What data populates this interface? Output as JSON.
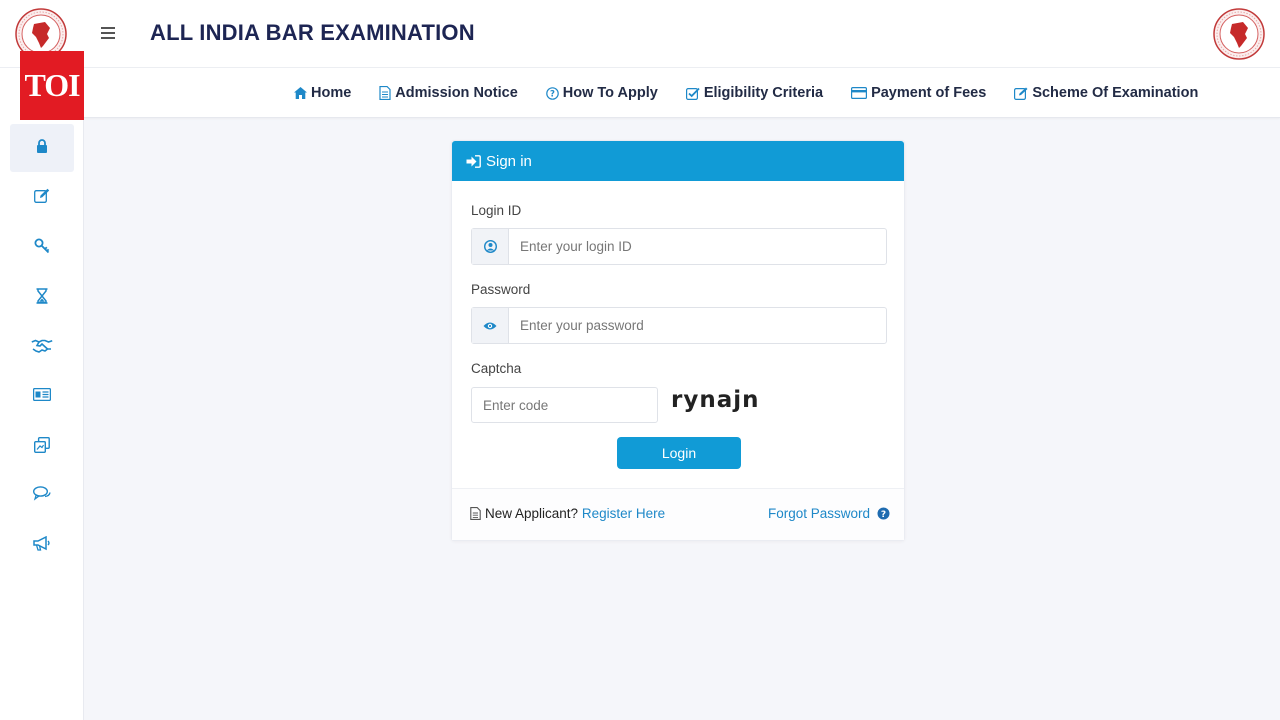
{
  "header": {
    "title": "ALL INDIA BAR EXAMINATION",
    "menu_icon": "hamburger-icon",
    "logo_left": "bar-council-emblem",
    "logo_right": "bar-council-emblem"
  },
  "overlay": {
    "badge": "TOI",
    "badge_color": "#e21b23"
  },
  "nav": {
    "items": [
      {
        "label": "Home",
        "icon": "home-icon"
      },
      {
        "label": "Admission Notice",
        "icon": "document-icon"
      },
      {
        "label": "How To Apply",
        "icon": "question-circle-icon"
      },
      {
        "label": "Eligibility Criteria",
        "icon": "check-square-icon"
      },
      {
        "label": "Payment of Fees",
        "icon": "credit-card-icon"
      },
      {
        "label": "Scheme Of Examination",
        "icon": "edit-icon"
      }
    ]
  },
  "sidebar": {
    "items": [
      {
        "icon": "lock-icon",
        "active": true
      },
      {
        "icon": "edit-icon"
      },
      {
        "icon": "key-icon"
      },
      {
        "icon": "hourglass-icon"
      },
      {
        "icon": "handshake-icon"
      },
      {
        "icon": "id-card-icon"
      },
      {
        "icon": "copy-icon"
      },
      {
        "icon": "chat-icon"
      },
      {
        "icon": "megaphone-icon"
      }
    ]
  },
  "signin": {
    "heading": "Sign in",
    "login_id_label": "Login ID",
    "login_id_placeholder": "Enter your login ID",
    "password_label": "Password",
    "password_placeholder": "Enter your password",
    "captcha_label": "Captcha",
    "captcha_placeholder": "Enter code",
    "captcha_code": "rynajn",
    "login_button": "Login",
    "new_applicant_text": "New Applicant?",
    "register_link": "Register Here",
    "forgot_link": "Forgot Password"
  },
  "colors": {
    "accent": "#119bd6",
    "title": "#1d2553",
    "link": "#1e88c8"
  }
}
